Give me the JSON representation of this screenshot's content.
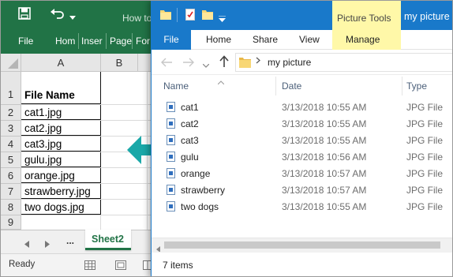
{
  "excel": {
    "title_partial": "How to",
    "ribbon_tabs": [
      "File",
      "Hom",
      "Inser",
      "Page",
      "For"
    ],
    "columns": [
      "A",
      "B"
    ],
    "rows": [
      {
        "num": "1",
        "value": "File Name"
      },
      {
        "num": "2",
        "value": "cat1.jpg"
      },
      {
        "num": "3",
        "value": "cat2.jpg"
      },
      {
        "num": "4",
        "value": "cat3.jpg"
      },
      {
        "num": "5",
        "value": "gulu.jpg"
      },
      {
        "num": "6",
        "value": "orange.jpg"
      },
      {
        "num": "7",
        "value": "strawberry.jpg"
      },
      {
        "num": "8",
        "value": "two dogs.jpg"
      },
      {
        "num": "9",
        "value": ""
      }
    ],
    "sheet_more": "...",
    "sheet_tab": "Sheet2",
    "status": "Ready",
    "accent": "#217346"
  },
  "explorer": {
    "window_title": "my picture",
    "contextual_group": "Picture Tools",
    "tabs": [
      "File",
      "Home",
      "Share",
      "View",
      "Manage"
    ],
    "path": "my picture",
    "columns": [
      "Name",
      "Date",
      "Type"
    ],
    "files": [
      {
        "name": "cat1",
        "date": "3/13/2018 10:55 AM",
        "type": "JPG File"
      },
      {
        "name": "cat2",
        "date": "3/13/2018 10:55 AM",
        "type": "JPG File"
      },
      {
        "name": "cat3",
        "date": "3/13/2018 10:55 AM",
        "type": "JPG File"
      },
      {
        "name": "gulu",
        "date": "3/13/2018 10:56 AM",
        "type": "JPG File"
      },
      {
        "name": "orange",
        "date": "3/13/2018 10:57 AM",
        "type": "JPG File"
      },
      {
        "name": "strawberry",
        "date": "3/13/2018 10:57 AM",
        "type": "JPG File"
      },
      {
        "name": "two dogs",
        "date": "3/13/2018 10:55 AM",
        "type": "JPG File"
      }
    ],
    "item_count": "7 items",
    "accent": "#1979ca",
    "contextual_color": "#fff8a8"
  },
  "arrow_color": "#1aa8a8"
}
